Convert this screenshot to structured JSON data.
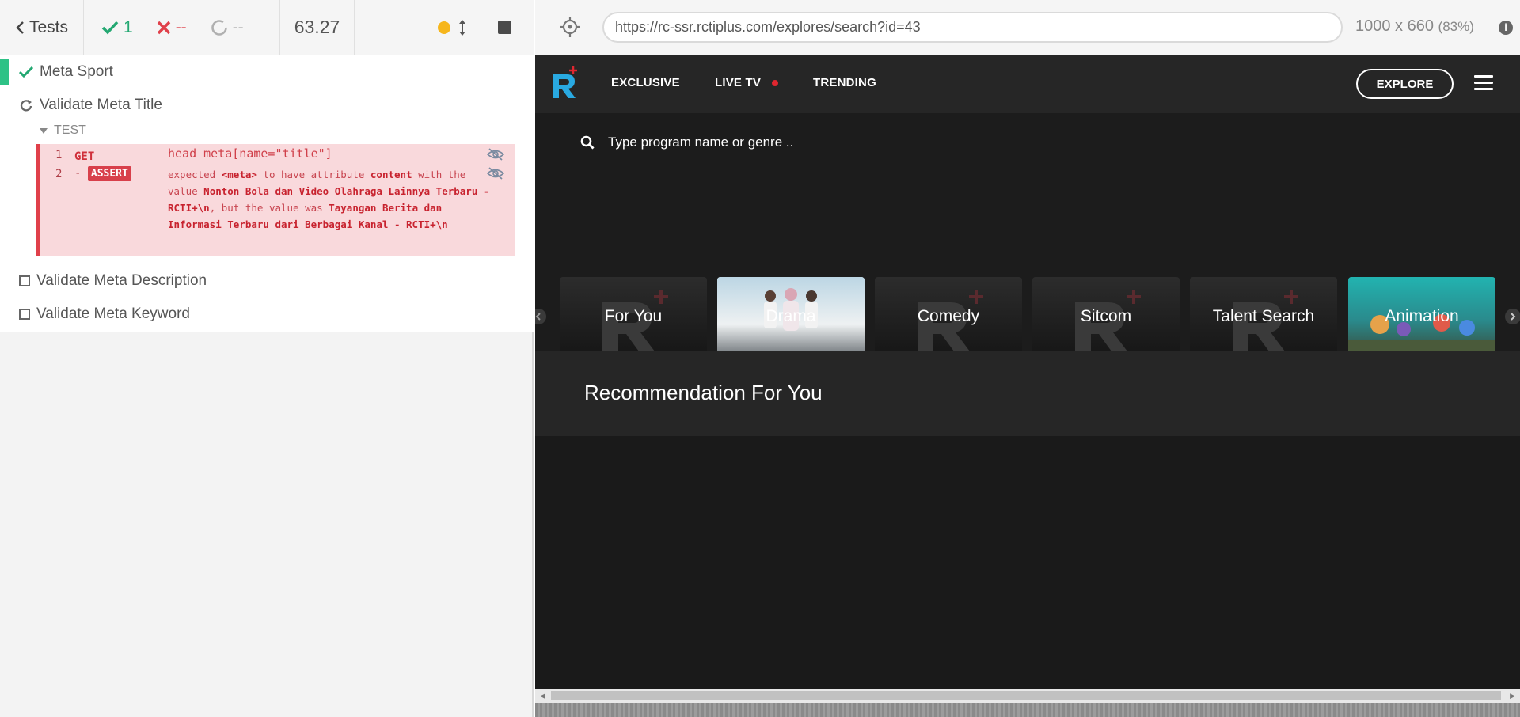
{
  "reporter": {
    "header": {
      "tests_label": "Tests",
      "passed": "1",
      "failed": "--",
      "pending": "--",
      "duration": "63.27"
    },
    "suite": {
      "title": "Meta Sport",
      "tests": [
        {
          "title": "Validate Meta Title",
          "state": "running"
        },
        {
          "title": "Validate Meta Description",
          "state": "pending"
        },
        {
          "title": "Validate Meta Keyword",
          "state": "pending"
        }
      ],
      "hook_label": "TEST",
      "commands": [
        {
          "num": "1",
          "name": "GET",
          "message": "head meta[name=\"title\"]"
        },
        {
          "num": "2",
          "prefix": "-",
          "name": "ASSERT",
          "msg_parts": {
            "p1": "expected",
            "b1": "<meta>",
            "p2": "to have attribute",
            "b2": "content",
            "p3": "with the value",
            "b3": "Nonton Bola dan Video Olahraga Lainnya Terbaru - RCTI+\\n",
            "p4": ", but the value was",
            "b4": "Tayangan Berita dan Informasi Terbaru dari Berbagai Kanal - RCTI+\\n"
          }
        }
      ]
    }
  },
  "aut": {
    "url": "https://rc-ssr.rctiplus.com/explores/search?id=43",
    "viewport": "1000 x 660",
    "scale": "(83%)",
    "info": "i"
  },
  "site": {
    "nav": [
      {
        "label": "EXCLUSIVE"
      },
      {
        "label": "LIVE TV"
      },
      {
        "label": "TRENDING"
      }
    ],
    "explore_label": "EXPLORE",
    "search_placeholder": "Type program name or genre ..",
    "genres": [
      "For You",
      "Drama",
      "Comedy",
      "Sitcom",
      "Talent Search",
      "Animation"
    ],
    "recommendation_title": "Recommendation For You",
    "colors": {
      "accent_red": "#e0262f",
      "logo_blue": "#29a9e1"
    }
  }
}
